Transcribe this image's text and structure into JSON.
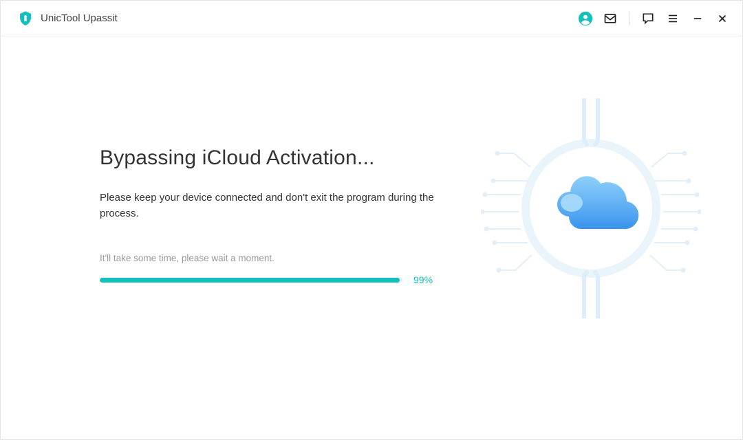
{
  "app": {
    "title": "UnicTool Upassit"
  },
  "titlebar": {
    "icons": {
      "account": "account-icon",
      "mail": "mail-icon",
      "chat": "chat-icon",
      "menu": "menu-icon",
      "minimize": "minimize-icon",
      "close": "close-icon"
    }
  },
  "main": {
    "heading": "Bypassing iCloud Activation...",
    "subtitle": "Please keep your device connected and don't exit the program during the process.",
    "wait_text": "It'll take some time, please wait a moment.",
    "progress": {
      "percent": 99,
      "label": "99%"
    }
  },
  "colors": {
    "accent": "#12c1bb",
    "cloud_light": "#7fc5f8",
    "cloud_dark": "#3a9cf0"
  }
}
